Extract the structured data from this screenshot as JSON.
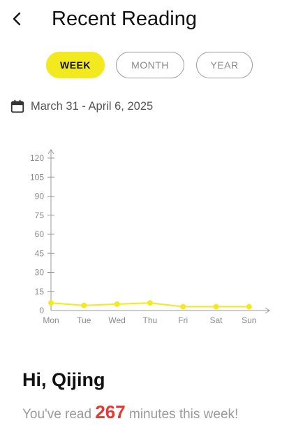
{
  "header": {
    "back_icon": "chevron-left-icon",
    "title": "Recent Reading"
  },
  "period_tabs": [
    {
      "label": "WEEK",
      "active": true
    },
    {
      "label": "MONTH",
      "active": false
    },
    {
      "label": "YEAR",
      "active": false
    }
  ],
  "date_range": {
    "icon": "calendar-icon",
    "text": "March 31 - April 6, 2025"
  },
  "colors": {
    "accent": "#f2ea1f",
    "highlight": "#e53935"
  },
  "chart_data": {
    "type": "line",
    "categories": [
      "Mon",
      "Tue",
      "Wed",
      "Thu",
      "Fri",
      "Sat",
      "Sun"
    ],
    "values": [
      6,
      4,
      5,
      6,
      3,
      3,
      3
    ],
    "ylim": [
      0,
      120
    ],
    "yticks": [
      0,
      15,
      30,
      45,
      60,
      75,
      90,
      105,
      120
    ],
    "grid": false,
    "line_color": "#f2ea1f"
  },
  "greeting": "Hi, Qijing",
  "summary": {
    "prefix": "You've read ",
    "minutes": "267",
    "suffix": " minutes this week!"
  }
}
